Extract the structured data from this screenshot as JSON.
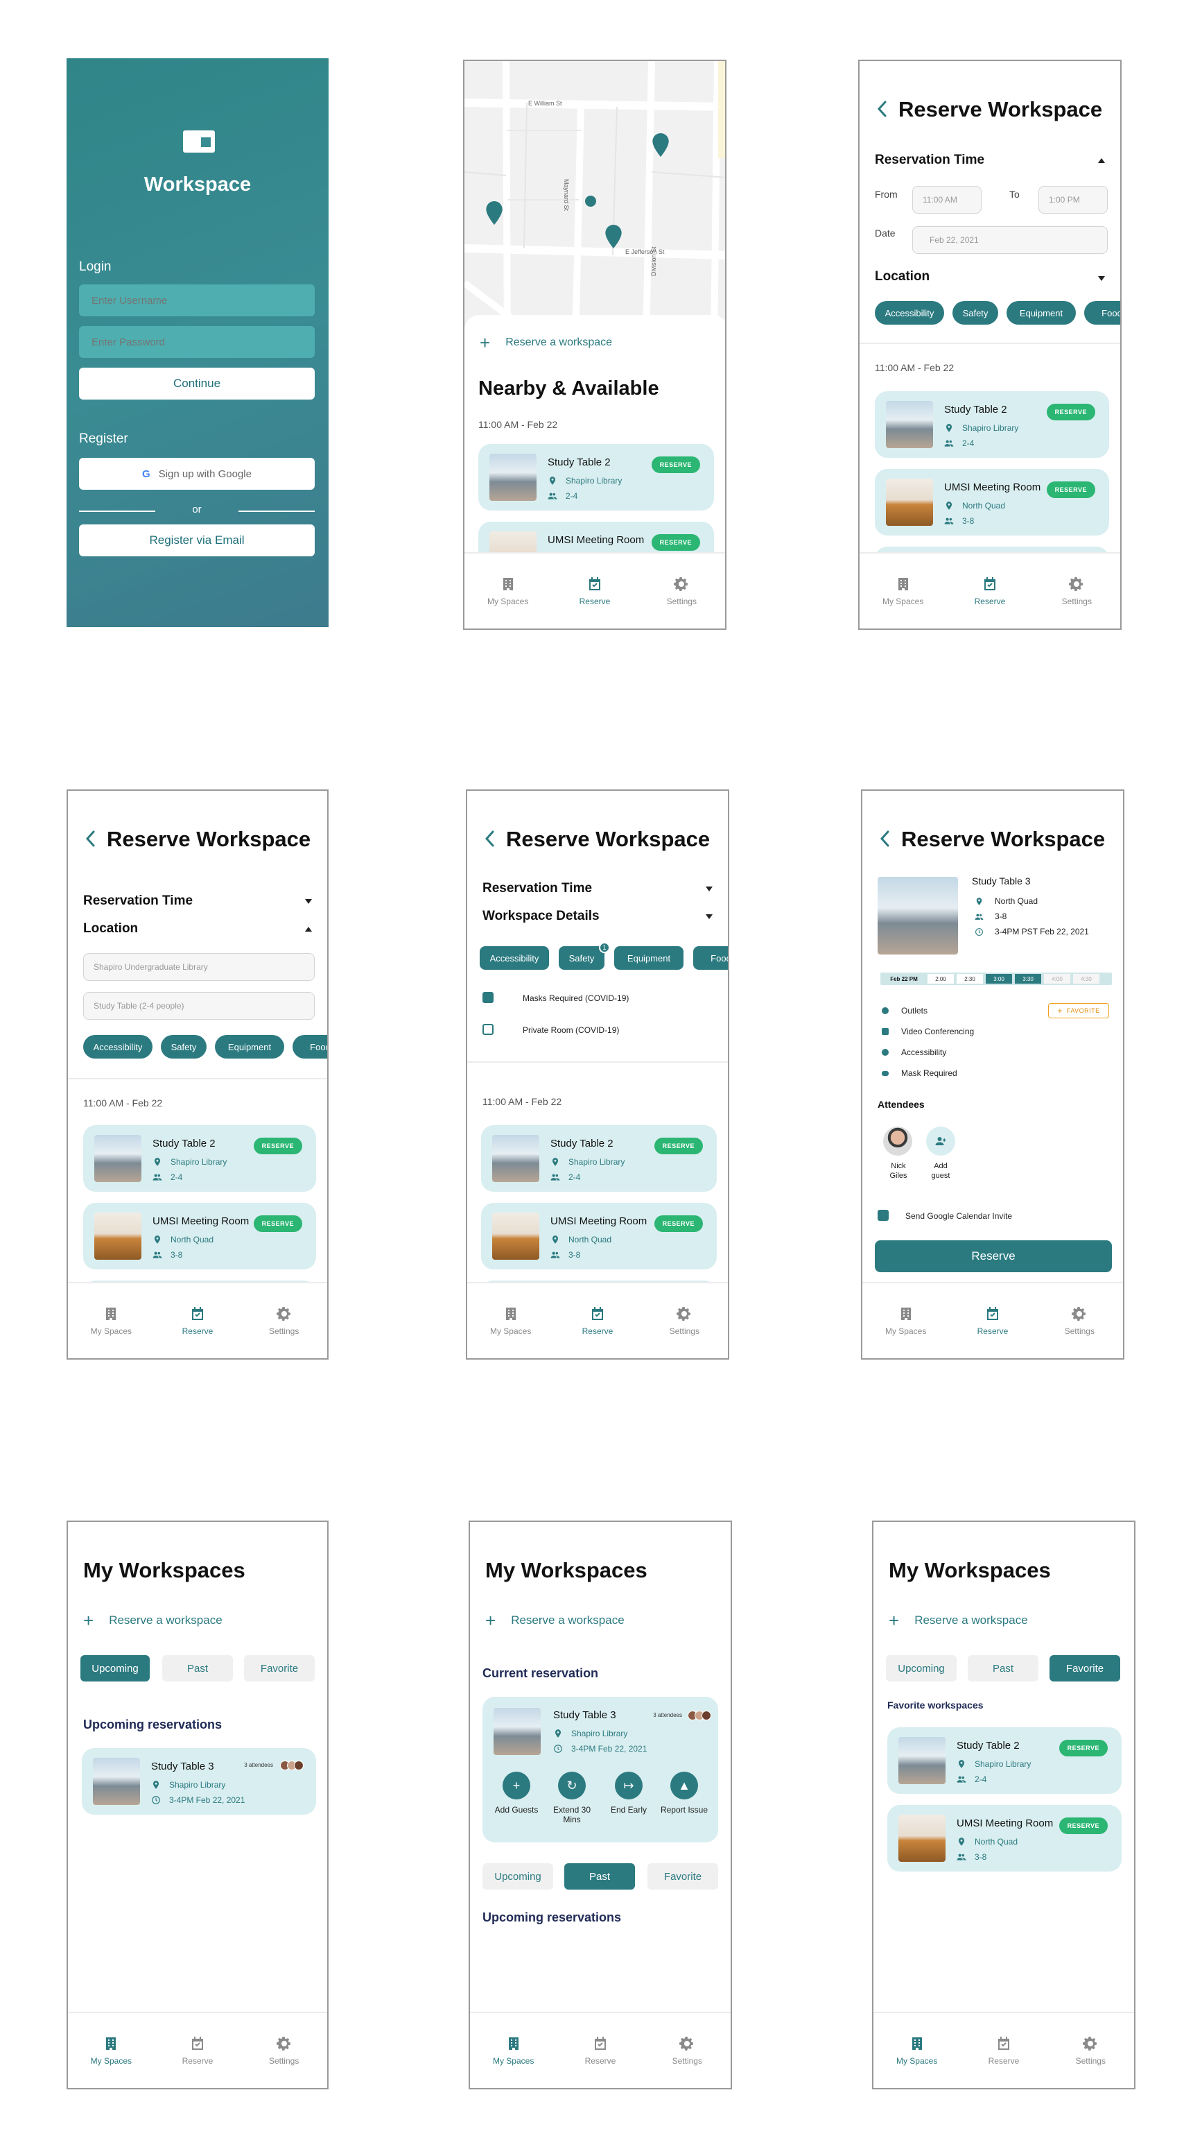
{
  "colors": {
    "accent": "#2b7a80",
    "card": "#d9eef0",
    "reserve_badge": "#2bb673"
  },
  "nav": {
    "spaces": "My Spaces",
    "reserve": "Reserve",
    "settings": "Settings"
  },
  "badge": "RESERVE",
  "login": {
    "brand": "Workspace",
    "login_header": "Login",
    "username_placeholder": "Enter Username",
    "password_placeholder": "Enter Password",
    "continue": "Continue",
    "register_header": "Register",
    "google": "Sign up with Google",
    "or": "or",
    "email": "Register via Email"
  },
  "map": {
    "streets": [
      "E William St",
      "E Jefferson St",
      "Maynard St",
      "Division St"
    ],
    "reserve_link": "Reserve a workspace",
    "title": "Nearby & Available",
    "datetime": "11:00 AM - Feb 22"
  },
  "reserve": {
    "title": "Reserve Workspace",
    "res_time": "Reservation Time",
    "location": "Location",
    "workspace_details": "Workspace Details",
    "from_label": "From",
    "from_value": "11:00 AM",
    "to_label": "To",
    "to_value": "1:00 PM",
    "date_label": "Date",
    "date_value": "Feb 22, 2021",
    "loc_placeholder": "Shapiro Undergraduate Library",
    "table_placeholder": "Study Table (2-4 people)",
    "datetime": "11:00 AM - Feb 22",
    "filters": [
      "Accessibility",
      "Safety",
      "Equipment",
      "Food"
    ],
    "safety_count": "1",
    "checks": [
      "Masks Required (COVID-19)",
      "Private Room (COVID-19)"
    ]
  },
  "spaces": [
    {
      "name": "Study Table 2",
      "location": "Shapiro Library",
      "capacity": "2-4"
    },
    {
      "name": "UMSI Meeting Room",
      "location": "North Quad",
      "capacity": "3-8"
    }
  ],
  "detail": {
    "name": "Study Table 3",
    "location": "North Quad",
    "capacity": "3-8",
    "time": "3-4PM PST Feb 22, 2021",
    "slots": [
      "Feb 22 PM",
      "2:00",
      "2:30",
      "3:00",
      "3:30",
      "4:00",
      "4:30"
    ],
    "amenities": [
      "Outlets",
      "Video Conferencing",
      "Accessibility",
      "Mask Required"
    ],
    "favorite": "FAVORITE",
    "attendees_label": "Attendees",
    "attendee": "Nick Giles",
    "add_guest": "Add guest",
    "calendar": "Send Google Calendar Invite",
    "reserve_btn": "Reserve"
  },
  "mywork": {
    "title": "My Workspaces",
    "reserve_link": "Reserve a workspace",
    "tabs": [
      "Upcoming",
      "Past",
      "Favorite"
    ],
    "upcoming_header": "Upcoming reservations",
    "current_header": "Current reservation",
    "favorite_header": "Favorite workspaces",
    "res": {
      "name": "Study Table 3",
      "attendees": "3 attendees",
      "location": "Shapiro Library",
      "time": "3-4PM Feb 22, 2021"
    },
    "actions": [
      "Add Guests",
      "Extend 30 Mins",
      "End Early",
      "Report Issue"
    ]
  }
}
